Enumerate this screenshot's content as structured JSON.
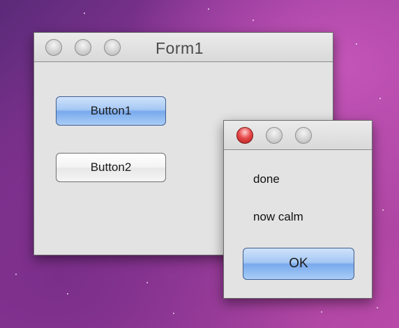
{
  "main_window": {
    "title": "Form1",
    "button1_label": "Button1",
    "button2_label": "Button2"
  },
  "dialog": {
    "line1": "done",
    "line2": "now calm",
    "ok_label": "OK"
  },
  "colors": {
    "default_button": "#79a9ec",
    "close_button_active": "#e84a4a",
    "window_bg": "#e3e3e3",
    "desktop": "#8a3596"
  }
}
